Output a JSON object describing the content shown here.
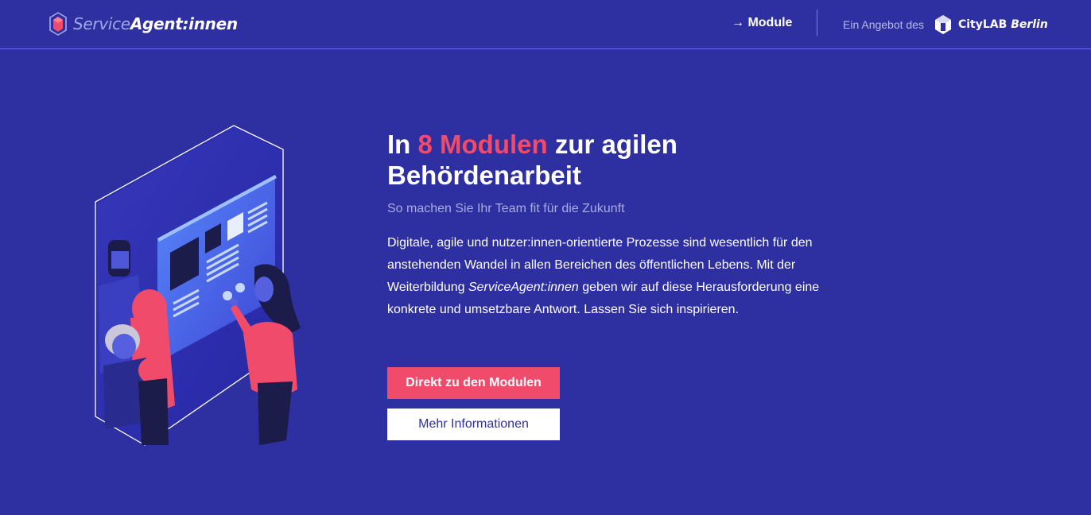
{
  "header": {
    "brand": {
      "part1": "Service",
      "part2": "Agent:innen",
      "icon": "hexagon-logo-icon"
    },
    "nav": {
      "module_arrow": "→",
      "module_label": "Module"
    },
    "offer": {
      "label": "Ein Angebot des",
      "partner_name": "CityLAB",
      "partner_city": "Berlin",
      "partner_icon": "citylab-logo-icon"
    }
  },
  "hero": {
    "title_prefix": "In ",
    "title_accent": "8 Modulen",
    "title_suffix": " zur agilen Behördenarbeit",
    "subtitle": "So machen Sie Ihr Team fit für die Zukunft",
    "body_part1": "Digitale, agile und nutzer:innen-orientierte Prozesse sind wesentlich für den anstehenden Wandel in allen Bereichen des öffentlichen Lebens. Mit der Weiterbildung ",
    "body_emphasis": "ServiceAgent:innen",
    "body_part2": " geben wir auf diese Herausforderung eine konkrete und umsetzbare Antwort. Lassen Sie sich inspirieren.",
    "primary_button": "Direkt zu den Modulen",
    "secondary_button": "Mehr Informationen"
  },
  "colors": {
    "background": "#2e2fa0",
    "accent": "#f14b6c",
    "subtitle": "#a9abe6",
    "text": "#ffffff"
  }
}
